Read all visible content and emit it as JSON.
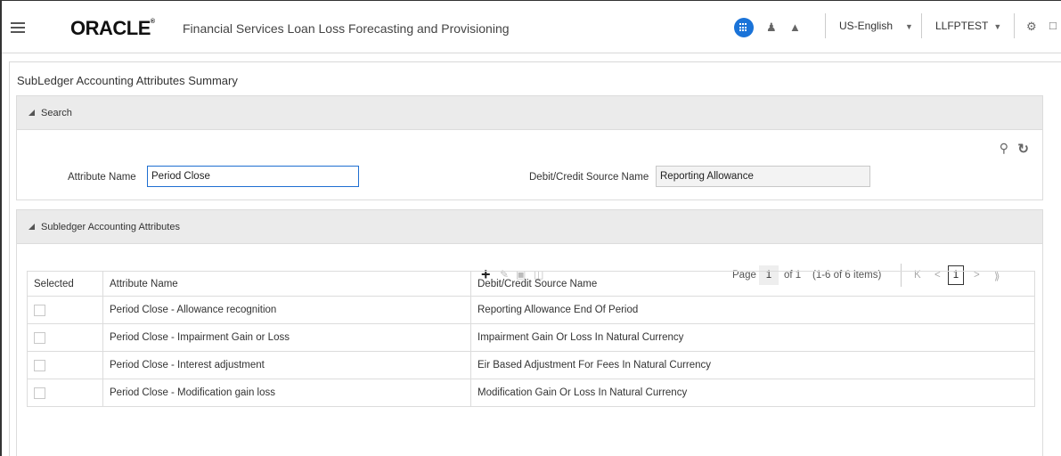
{
  "header": {
    "logo": "ORACLE",
    "logo_mark": "®",
    "app_title": "Financial Services Loan Loss Forecasting and Provisioning",
    "language": "US-English",
    "user": "LLFPTEST",
    "icons": [
      "hamburger-icon",
      "apps-icon",
      "user-tool-icon",
      "hat-icon",
      "sitemap-icon",
      "cut-icon"
    ],
    "accent_color": "#1a73d8"
  },
  "page": {
    "title": "SubLedger Accounting Attributes Summary"
  },
  "search": {
    "panel_title": "Search",
    "attribute_label": "Attribute Name",
    "attribute_value": "Period Close",
    "source_label": "Debit/Credit Source Name",
    "source_value": "Reporting Allowance"
  },
  "grid": {
    "panel_title": "Subledger Accounting Attributes",
    "pager": {
      "page_label": "Page",
      "page_value": "1",
      "of_label": "of 1",
      "items_label": "(1-6 of 6 items)",
      "first": "K",
      "prev": "<",
      "current": "1",
      "next": ">",
      "last": "⟫"
    },
    "columns": [
      "Selected",
      "Attribute Name",
      "Debit/Credit Source Name"
    ],
    "rows": [
      {
        "attribute": "Period Close - Allowance recognition",
        "source": "Reporting Allowance End Of Period"
      },
      {
        "attribute": "Period Close - Impairment Gain or Loss",
        "source": "Impairment Gain Or Loss In Natural Currency"
      },
      {
        "attribute": "Period Close - Interest adjustment",
        "source": "Eir Based Adjustment For Fees In Natural Currency"
      },
      {
        "attribute": "Period Close - Modification gain loss",
        "source": "Modification Gain Or Loss In Natural Currency"
      }
    ]
  }
}
